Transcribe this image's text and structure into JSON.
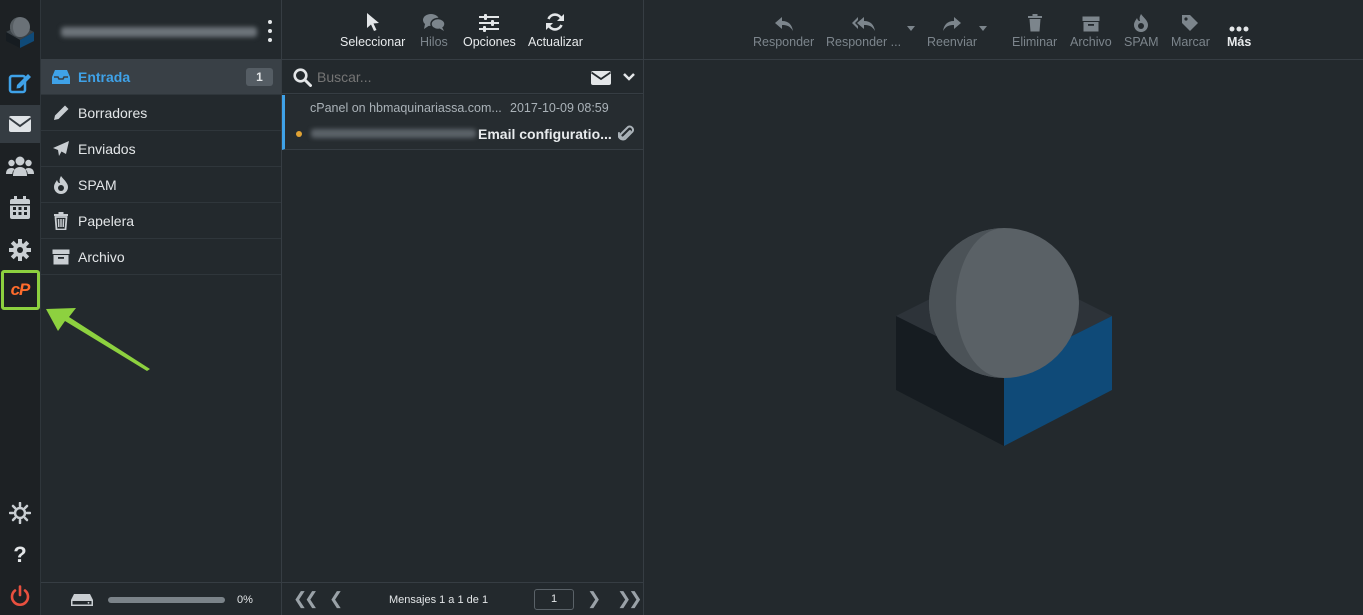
{
  "rail": {
    "items": [
      {
        "name": "compose",
        "icon": "compose-icon"
      },
      {
        "name": "mail",
        "icon": "mail-icon"
      },
      {
        "name": "contacts",
        "icon": "contacts-icon"
      },
      {
        "name": "calendar",
        "icon": "calendar-icon"
      },
      {
        "name": "settings",
        "icon": "gear-icon"
      },
      {
        "name": "cpanel",
        "icon": "cpanel-icon",
        "label": "cP"
      }
    ],
    "bottom": [
      {
        "name": "theme",
        "icon": "sun-icon"
      },
      {
        "name": "help",
        "icon": "help-icon",
        "label": "?"
      },
      {
        "name": "logout",
        "icon": "power-icon"
      }
    ],
    "accent": "#3fa2e8",
    "highlight_color": "#8dd13f"
  },
  "folders": {
    "items": [
      {
        "label": "Entrada",
        "icon": "inbox-icon",
        "unread": "1",
        "selected": true
      },
      {
        "label": "Borradores",
        "icon": "pencil-icon"
      },
      {
        "label": "Enviados",
        "icon": "paper-plane-icon"
      },
      {
        "label": "SPAM",
        "icon": "fire-icon"
      },
      {
        "label": "Papelera",
        "icon": "trash-icon"
      },
      {
        "label": "Archivo",
        "icon": "archive-icon"
      }
    ],
    "quota": {
      "percent_text": "0%",
      "fraction": 0
    }
  },
  "list_toolbar": {
    "select": "Seleccionar",
    "threads": "Hilos",
    "options": "Opciones",
    "refresh": "Actualizar"
  },
  "search": {
    "placeholder": "Buscar..."
  },
  "messages": [
    {
      "from": "cPanel on hbmaquinariassa.com...",
      "date": "2017-10-09 08:59",
      "subject": "Email configuratio...",
      "unread_dot_color": "#e0a234",
      "has_attachment": true
    }
  ],
  "pager": {
    "text": "Mensajes 1 a 1 de 1",
    "page": "1"
  },
  "preview_toolbar": {
    "reply": "Responder",
    "reply_all": "Responder ...",
    "forward": "Reenviar",
    "delete": "Eliminar",
    "archive": "Archivo",
    "spam": "SPAM",
    "mark": "Marcar",
    "more": "Más"
  },
  "colors": {
    "logo_blue": "#0f4a78",
    "logo_dark": "#161c21",
    "logo_sphere": "#5a6166",
    "arrow": "#8dd13f"
  }
}
